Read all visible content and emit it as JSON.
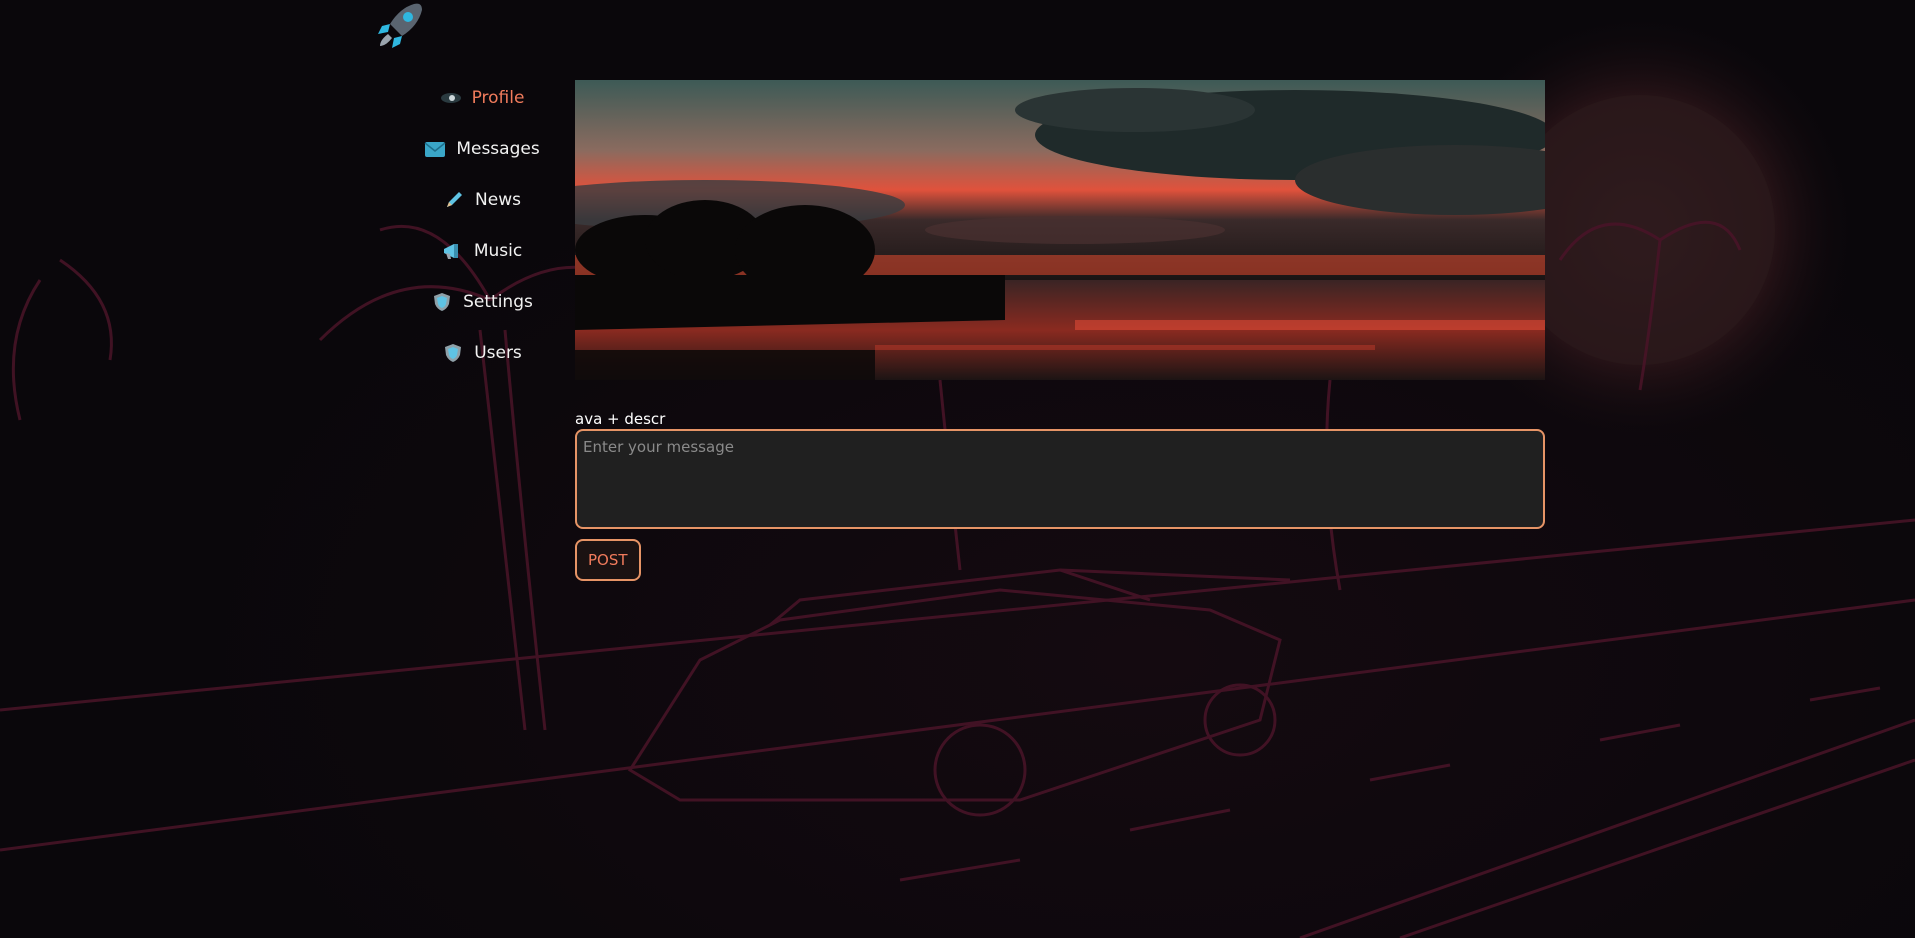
{
  "logo": {
    "icon": "rocket-icon"
  },
  "nav": {
    "items": [
      {
        "label": "Profile",
        "icon": "eye-icon",
        "active": true
      },
      {
        "label": "Messages",
        "icon": "envelope-icon",
        "active": false
      },
      {
        "label": "News",
        "icon": "pencil-icon",
        "active": false
      },
      {
        "label": "Music",
        "icon": "megaphone-icon",
        "active": false
      },
      {
        "label": "Settings",
        "icon": "shield-icon",
        "active": false
      },
      {
        "label": "Users",
        "icon": "shield-icon",
        "active": false
      }
    ]
  },
  "profile": {
    "description": "ava + descr",
    "message_placeholder": "Enter your message",
    "message_value": "",
    "post_label": "POST"
  },
  "colors": {
    "accent": "#f07b5c",
    "border": "#e69466",
    "background": "#0a070b",
    "input_bg": "#202020"
  }
}
